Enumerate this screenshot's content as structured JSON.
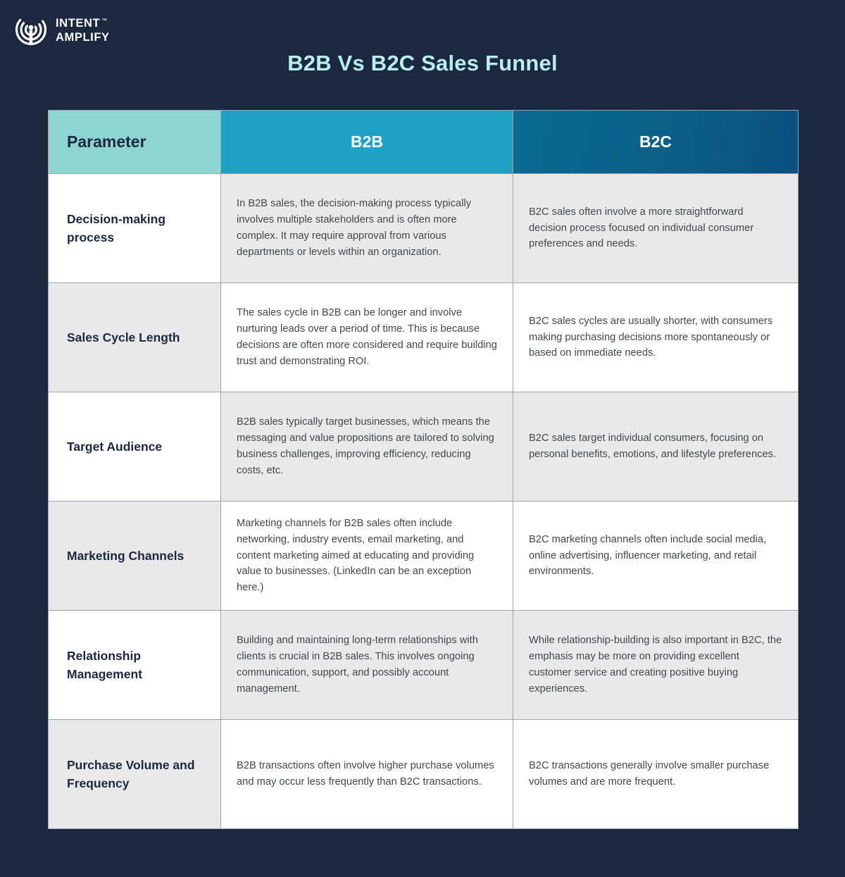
{
  "brand": {
    "logo_icon": "signal-waves-icon",
    "line1": "Intent",
    "line2": "Amplify",
    "trademark": "™"
  },
  "title": "B2B Vs B2C Sales Funnel",
  "colors": {
    "background": "#1c2740",
    "title": "#b9f0ee",
    "header_parameter_bg": "#8ed4d1",
    "header_b2b_bg": "#1fa0c4",
    "header_b2c_bg": "#0b5f87",
    "cell_grey": "#e9e9e9",
    "cell_white": "#ffffff",
    "border": "#9aa3ab",
    "param_text": "#1c2740",
    "body_text": "#44484d"
  },
  "table": {
    "headers": {
      "parameter": "Parameter",
      "b2b": "B2B",
      "b2c": "B2C"
    },
    "rows": [
      {
        "parameter": "Decision-making process",
        "b2b": "In B2B sales, the decision-making process typically involves multiple stakeholders and is often more complex. It may require approval from various departments or levels within an organization.",
        "b2c": "B2C sales often involve a more straightforward decision process focused on individual consumer preferences and needs."
      },
      {
        "parameter": "Sales Cycle Length",
        "b2b": "The sales cycle in B2B can be longer and involve nurturing leads over a period of time. This is because decisions are often more considered and require building trust and demonstrating ROI.",
        "b2c": "B2C sales cycles are usually shorter, with consumers making purchasing decisions more spontaneously or based on immediate needs."
      },
      {
        "parameter": "Target Audience",
        "b2b": "B2B sales typically target businesses, which means the messaging and value propositions are tailored to solving business challenges, improving efficiency, reducing costs, etc.",
        "b2c": "B2C sales target individual consumers, focusing on personal benefits, emotions, and lifestyle preferences."
      },
      {
        "parameter": "Marketing Channels",
        "b2b": "Marketing channels for B2B sales often include networking, industry events, email marketing, and content marketing aimed at educating and providing value to businesses. (LinkedIn can be an exception here.)",
        "b2c": "B2C marketing channels often include social media, online advertising, influencer marketing, and retail environments."
      },
      {
        "parameter": "Relationship Management",
        "b2b": "Building and maintaining long-term relationships with clients is crucial in B2B sales. This involves ongoing communication, support, and possibly account management.",
        "b2c": "While relationship-building is also important in B2C, the emphasis may be more on providing excellent customer service and creating positive buying experiences."
      },
      {
        "parameter": "Purchase Volume and Frequency",
        "b2b": "B2B transactions often involve higher purchase volumes and may occur less frequently than B2C transactions.",
        "b2c": "B2C transactions generally involve smaller purchase volumes and are more frequent."
      }
    ]
  }
}
